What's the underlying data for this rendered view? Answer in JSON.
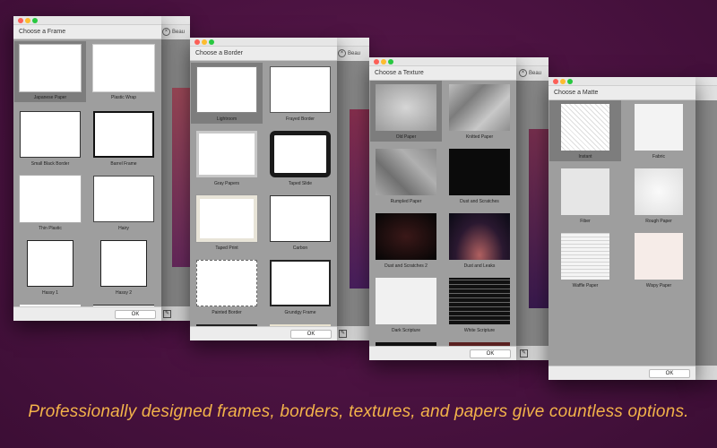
{
  "side_title_partial": "Beau",
  "ok_label": "OK",
  "caption": "Professionally designed frames, borders, textures, and papers give countless options.",
  "frame_panel": {
    "title": "Choose a Frame",
    "items": [
      "Japanese Paper",
      "Plastic Wrap",
      "Small Black Border",
      "Barrel Frame",
      "Thin Plastic",
      "Hairy",
      "Hassy 1",
      "Hassy 2"
    ]
  },
  "border_panel": {
    "title": "Choose a Border",
    "items": [
      "Lightroom",
      "Frayed Border",
      "Gray Papers",
      "Taped Slide",
      "Taped Print",
      "Carbon",
      "Painted Border",
      "Grundgy Frame"
    ]
  },
  "texture_panel": {
    "title": "Choose a Texture",
    "items": [
      "Old Paper",
      "Knitted Paper",
      "Rumpled Paper",
      "Dust and Scratches",
      "Dust and Scratches 2",
      "Dust and Leaks",
      "Dark Scripture",
      "White Scripture"
    ]
  },
  "matte_panel": {
    "title": "Choose a Matte",
    "items": [
      "Instant",
      "Fabric",
      "Fiber",
      "Rough Paper",
      "Waffle Paper",
      "Wispy Paper"
    ]
  }
}
